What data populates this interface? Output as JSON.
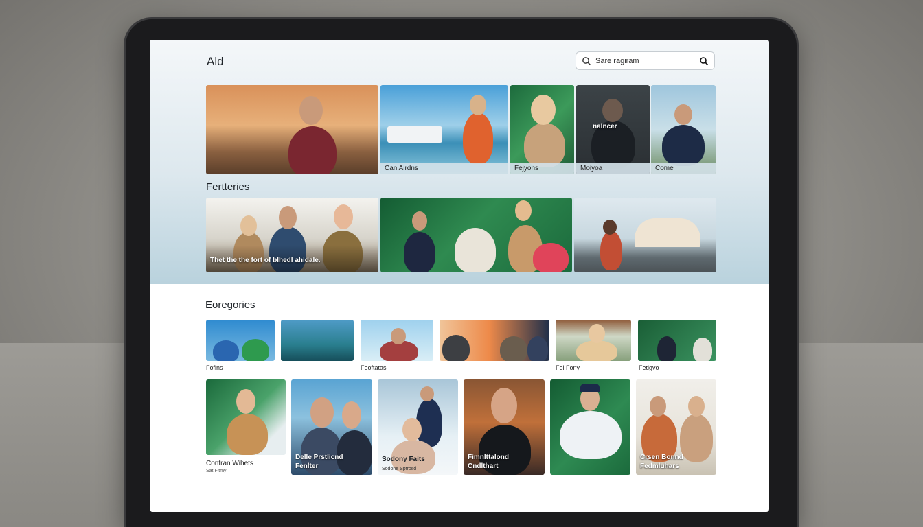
{
  "app": {
    "title": "Ald"
  },
  "search": {
    "value": "Sare ragiram"
  },
  "featured_row": [
    {
      "caption": ""
    },
    {
      "caption": "Can Airdns"
    },
    {
      "caption": "Fejyons"
    },
    {
      "caption": "Moiyoa",
      "overlay": "nalncer"
    },
    {
      "caption": "Come"
    }
  ],
  "section2": {
    "title": "Fertteries"
  },
  "wide_row": [
    {
      "overlay": "Thet the the fort of blhedl ahidale."
    },
    {
      "overlay": ""
    },
    {
      "overlay": ""
    }
  ],
  "categories": {
    "title": "Eoregories",
    "row1_labels": [
      "Fofins",
      "",
      "Feoftatas",
      "",
      "Fol Fony",
      "Fetigvo"
    ],
    "row2": [
      {
        "title": "Confran Wihets",
        "subtitle": "Sat Fitmy"
      },
      {
        "title": "Delle Prstlicnd Fenlter"
      },
      {
        "title": "Sodony Faits",
        "subtitle": "Sodone Sptrosd"
      },
      {
        "title": "Fimnlttalond Cndlthart"
      },
      {
        "title": ""
      },
      {
        "title": "Crsen Bonnd Fedmluhars"
      }
    ]
  },
  "colors": {
    "screen_bg": "#ffffff",
    "hero_gradient_bottom": "#b9d2dd",
    "text": "#1e2328",
    "caption_bar": "#d2e1e8"
  }
}
